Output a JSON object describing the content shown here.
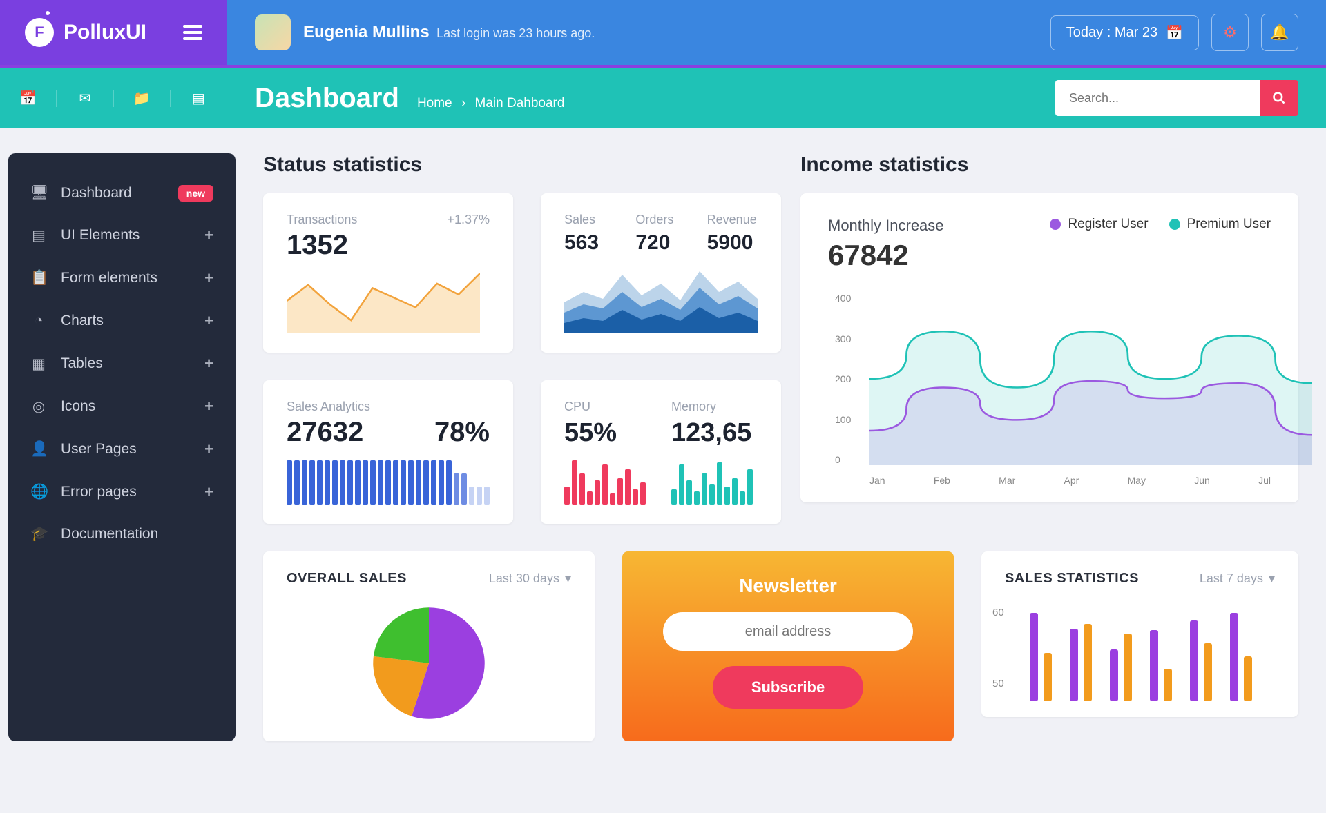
{
  "brand": {
    "name": "PolluxUI",
    "logo_letter": "F"
  },
  "header": {
    "user_name": "Eugenia Mullins",
    "last_login": "Last login was 23 hours ago.",
    "today_label": "Today : Mar 23"
  },
  "subheader": {
    "page_title": "Dashboard",
    "breadcrumb_home": "Home",
    "breadcrumb_current": "Main Dahboard",
    "search_placeholder": "Search..."
  },
  "sidebar": {
    "items": [
      {
        "label": "Dashboard",
        "badge": "new"
      },
      {
        "label": "UI Elements",
        "expand": "+"
      },
      {
        "label": "Form elements",
        "expand": "+"
      },
      {
        "label": "Charts",
        "expand": "+"
      },
      {
        "label": "Tables",
        "expand": "+"
      },
      {
        "label": "Icons",
        "expand": "+"
      },
      {
        "label": "User Pages",
        "expand": "+"
      },
      {
        "label": "Error pages",
        "expand": "+"
      },
      {
        "label": "Documentation"
      }
    ]
  },
  "status": {
    "title": "Status statistics",
    "transactions": {
      "label": "Transactions",
      "change": "+1.37%",
      "value": "1352"
    },
    "sor": {
      "sales": {
        "label": "Sales",
        "value": "563"
      },
      "orders": {
        "label": "Orders",
        "value": "720"
      },
      "revenue": {
        "label": "Revenue",
        "value": "5900"
      }
    },
    "analytics": {
      "label": "Sales Analytics",
      "value": "27632",
      "pct": "78%"
    },
    "sys": {
      "cpu": {
        "label": "CPU",
        "value": "55%"
      },
      "memory": {
        "label": "Memory",
        "value": "123,65"
      }
    }
  },
  "income": {
    "title": "Income statistics",
    "label": "Monthly Increase",
    "value": "67842",
    "legend_register": "Register User",
    "legend_premium": "Premium User"
  },
  "overall_sales": {
    "title": "OVERALL SALES",
    "range": "Last 30 days"
  },
  "newsletter": {
    "title": "Newsletter",
    "placeholder": "email address",
    "button": "Subscribe"
  },
  "sales_stats": {
    "title": "SALES STATISTICS",
    "range": "Last 7 days"
  },
  "chart_data": [
    {
      "id": "transactions_spark",
      "type": "line",
      "title": "Transactions",
      "color_line": "#f2a33c",
      "color_fill": "#fce7c6",
      "values": [
        45,
        70,
        40,
        15,
        65,
        50,
        35,
        72,
        55,
        88
      ]
    },
    {
      "id": "sor_area",
      "type": "area",
      "title": "Sales/Orders/Revenue",
      "series": [
        {
          "name": "back",
          "color": "#bcd4ea",
          "values": [
            45,
            60,
            50,
            85,
            55,
            72,
            48,
            90,
            60,
            75,
            50
          ]
        },
        {
          "name": "mid",
          "color": "#5d97d2",
          "values": [
            30,
            42,
            36,
            60,
            38,
            50,
            34,
            66,
            42,
            54,
            36
          ]
        },
        {
          "name": "front",
          "color": "#1b5fa7",
          "values": [
            15,
            22,
            18,
            34,
            20,
            28,
            18,
            38,
            22,
            30,
            18
          ]
        }
      ]
    },
    {
      "id": "analytics_bars",
      "type": "bar",
      "title": "Sales Analytics",
      "palette": {
        "full": "#3964d8",
        "mid": "#6e8ce3",
        "light": "#c6d3f4"
      },
      "values": [
        100,
        100,
        100,
        100,
        100,
        100,
        100,
        100,
        100,
        100,
        100,
        100,
        100,
        100,
        100,
        100,
        100,
        100,
        100,
        100,
        100,
        100,
        70,
        70,
        40,
        40,
        40
      ]
    },
    {
      "id": "cpu_bars",
      "type": "bar",
      "title": "CPU",
      "color": "#ef3a5d",
      "values": [
        40,
        100,
        70,
        30,
        55,
        90,
        25,
        60,
        80,
        35,
        50
      ]
    },
    {
      "id": "memory_bars",
      "type": "bar",
      "title": "Memory",
      "color": "#1fc2b6",
      "values": [
        35,
        90,
        55,
        30,
        70,
        45,
        95,
        40,
        60,
        30,
        80
      ]
    },
    {
      "id": "income_line",
      "type": "line",
      "title": "Monthly Increase",
      "xlabel": "",
      "ylabel": "",
      "ylim": [
        0,
        400
      ],
      "categories": [
        "Jan",
        "Feb",
        "Mar",
        "Apr",
        "May",
        "Jun",
        "Jul"
      ],
      "series": [
        {
          "name": "Register User",
          "color": "#9b59e0",
          "values": [
            80,
            180,
            105,
            195,
            155,
            190,
            70
          ]
        },
        {
          "name": "Premium User",
          "color": "#1fc2b6",
          "values": [
            200,
            310,
            180,
            310,
            200,
            300,
            190
          ]
        }
      ]
    },
    {
      "id": "overall_sales_pie",
      "type": "pie",
      "title": "OVERALL SALES",
      "slices": [
        {
          "name": "purple",
          "color": "#9b3fe0",
          "pct": 55
        },
        {
          "name": "orange",
          "color": "#f29b1d",
          "pct": 22
        },
        {
          "name": "green",
          "color": "#3fbf2f",
          "pct": 23
        }
      ]
    },
    {
      "id": "sales_stats_bars",
      "type": "bar",
      "title": "SALES STATISTICS",
      "ylim": [
        0,
        60
      ],
      "y_ticks": [
        60,
        50
      ],
      "series": [
        {
          "name": "purple",
          "color": "#9b3fe0",
          "values": [
            55,
            45,
            32,
            44,
            50,
            55
          ]
        },
        {
          "name": "orange",
          "color": "#f29b1d",
          "values": [
            30,
            48,
            42,
            20,
            36,
            28
          ]
        }
      ]
    }
  ]
}
